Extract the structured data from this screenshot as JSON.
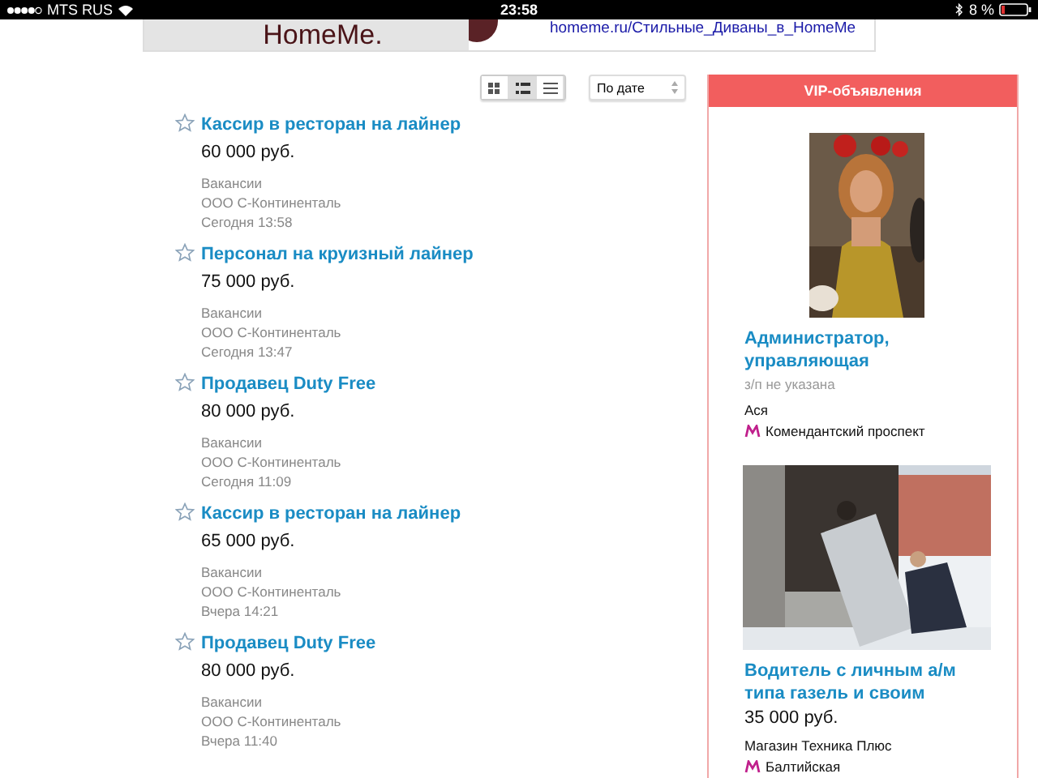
{
  "status_bar": {
    "carrier": "MTS RUS",
    "time": "23:58",
    "battery": "8 %"
  },
  "banner": {
    "logo": "HomeMe.",
    "link": "homeme.ru/Стильные_Диваны_в_HomeMe"
  },
  "toolbar": {
    "views": [
      {
        "kind": "grid",
        "selected": false
      },
      {
        "kind": "list",
        "selected": true
      },
      {
        "kind": "lines",
        "selected": false
      }
    ],
    "sort": {
      "value": "По дате"
    }
  },
  "listings": [
    {
      "title": "Кассир в ресторан на лайнер",
      "price": "60 000 руб.",
      "category": "Вакансии",
      "company": "ООО С-Континенталь",
      "date": "Сегодня 13:58"
    },
    {
      "title": "Персонал на круизный лайнер",
      "price": "75 000 руб.",
      "category": "Вакансии",
      "company": "ООО С-Континенталь",
      "date": "Сегодня 13:47"
    },
    {
      "title": "Продавец Duty Free",
      "price": "80 000 руб.",
      "category": "Вакансии",
      "company": "ООО С-Континенталь",
      "date": "Сегодня 11:09"
    },
    {
      "title": "Кассир в ресторан на лайнер",
      "price": "65 000 руб.",
      "category": "Вакансии",
      "company": "ООО С-Континенталь",
      "date": "Вчера 14:21"
    },
    {
      "title": "Продавец Duty Free",
      "price": "80 000 руб.",
      "category": "Вакансии",
      "company": "ООО С-Континенталь",
      "date": "Вчера 11:40"
    }
  ],
  "vip": {
    "title": "VIP-объявления",
    "items": [
      {
        "title": "Администратор, управляющая",
        "salary": "з/п не указана",
        "salary_muted": true,
        "contact": "Ася",
        "metro": "Комендантский проспект"
      },
      {
        "title": "Водитель с личным а/м типа газель и своим",
        "salary": "35 000 руб.",
        "salary_muted": false,
        "contact": "Магазин Техника Плюс",
        "metro": "Балтийская"
      }
    ]
  }
}
